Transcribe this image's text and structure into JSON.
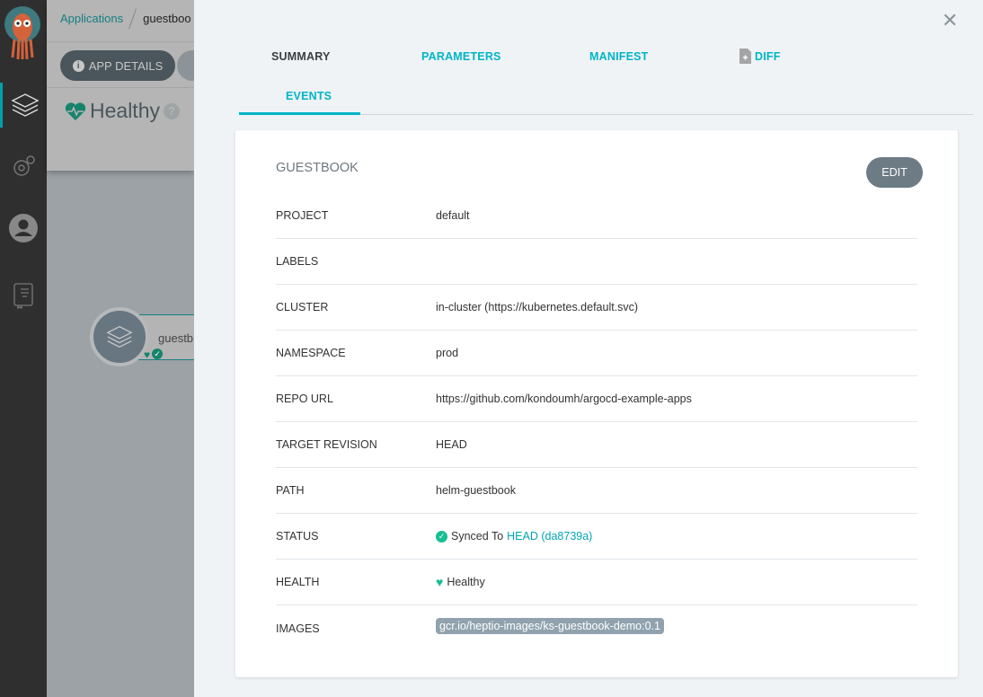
{
  "breadcrumb": {
    "root": "Applications",
    "current": "guestboo"
  },
  "toolbar": {
    "app_details": "APP DETAILS"
  },
  "status": {
    "health": "Healthy"
  },
  "tree": {
    "node_name": "guestb"
  },
  "tabs": [
    {
      "label": "SUMMARY"
    },
    {
      "label": "PARAMETERS"
    },
    {
      "label": "MANIFEST"
    },
    {
      "label": "DIFF"
    },
    {
      "label": "EVENTS"
    }
  ],
  "card": {
    "title": "GUESTBOOK",
    "edit": "EDIT"
  },
  "rows": {
    "project": {
      "k": "PROJECT",
      "v": "default"
    },
    "labels": {
      "k": "LABELS",
      "v": ""
    },
    "cluster": {
      "k": "CLUSTER",
      "v": "in-cluster (https://kubernetes.default.svc)"
    },
    "namespace": {
      "k": "NAMESPACE",
      "v": "prod"
    },
    "repo": {
      "k": "REPO URL",
      "v": "https://github.com/kondoumh/argocd-example-apps"
    },
    "target": {
      "k": "TARGET REVISION",
      "v": "HEAD"
    },
    "path": {
      "k": "PATH",
      "v": "helm-guestbook"
    },
    "status": {
      "k": "STATUS",
      "v": "Synced To",
      "rev": "HEAD (da8739a)"
    },
    "health": {
      "k": "HEALTH",
      "v": "Healthy"
    },
    "images": {
      "k": "IMAGES",
      "v": "gcr.io/heptio-images/ks-guestbook-demo:0.1"
    }
  },
  "colors": {
    "accent": "#00b5c6",
    "healthy": "#18be94",
    "sidebar": "#2f2f2f"
  }
}
